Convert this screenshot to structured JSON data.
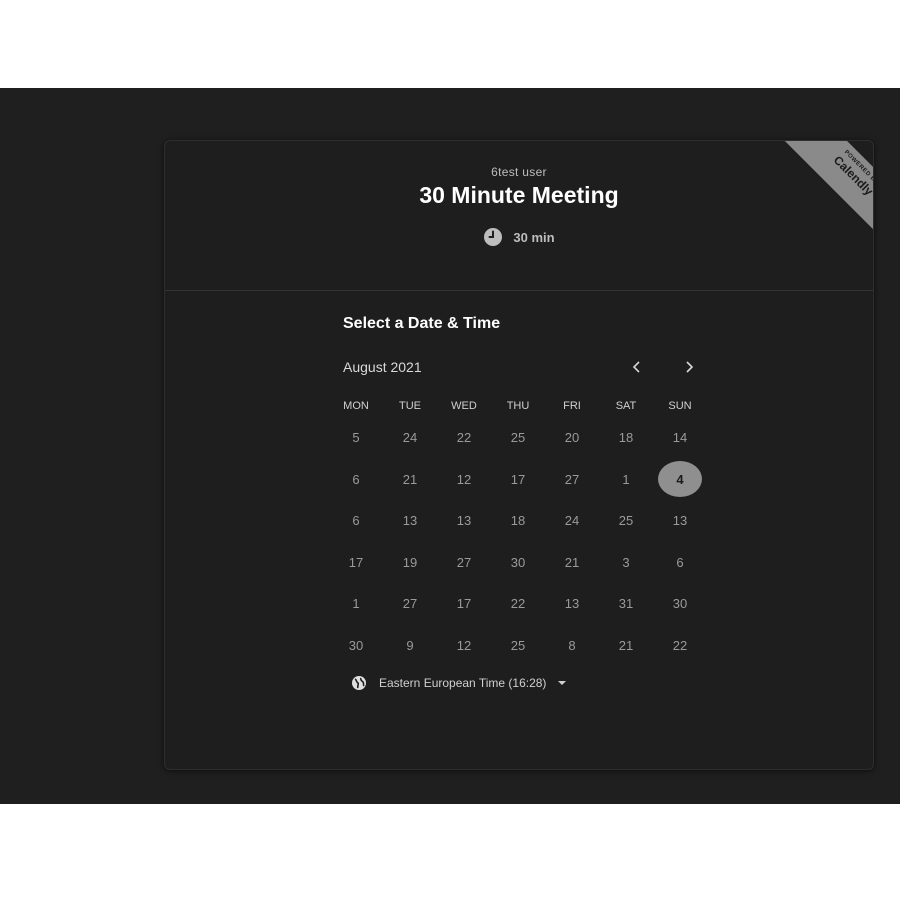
{
  "header": {
    "owner": "6test user",
    "title": "30 Minute Meeting",
    "duration": "30 min"
  },
  "ribbon": {
    "powered_by": "POWERED BY",
    "brand": "Calendly"
  },
  "calendar": {
    "heading": "Select a Date & Time",
    "month": "August 2021",
    "prev_icon": "chevron-left-icon",
    "next_icon": "chevron-right-icon",
    "weekdays": [
      "MON",
      "TUE",
      "WED",
      "THU",
      "FRI",
      "SAT",
      "SUN"
    ],
    "weeks": [
      [
        "5",
        "24",
        "22",
        "25",
        "20",
        "18",
        "14"
      ],
      [
        "6",
        "21",
        "12",
        "17",
        "27",
        "1",
        "4"
      ],
      [
        "6",
        "13",
        "13",
        "18",
        "24",
        "25",
        "13"
      ],
      [
        "17",
        "19",
        "27",
        "30",
        "21",
        "3",
        "6"
      ],
      [
        "1",
        "27",
        "17",
        "22",
        "13",
        "31",
        "30"
      ],
      [
        "30",
        "9",
        "12",
        "25",
        "8",
        "21",
        "22"
      ]
    ],
    "selected_day": "4"
  },
  "timezone": {
    "label": "Eastern European Time (16:28)",
    "icon": "globe-icon"
  },
  "colors": {
    "background": "#1f1f1f",
    "card": "#1e1e1e",
    "selected": "#8f8f8f"
  }
}
